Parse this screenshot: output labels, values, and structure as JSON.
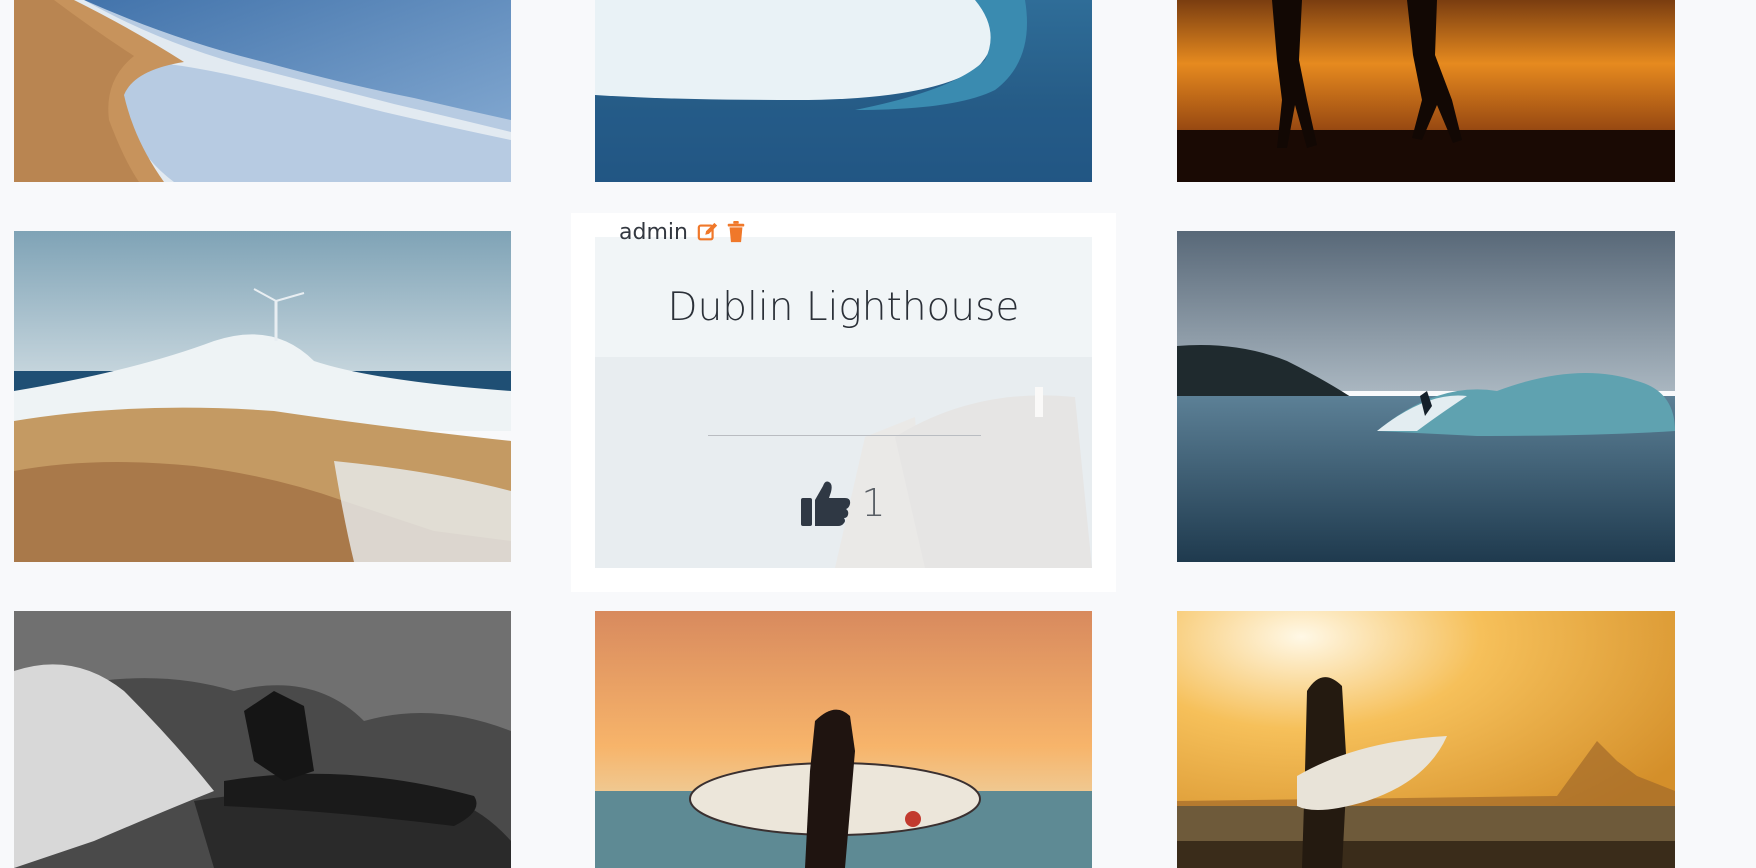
{
  "gallery": {
    "photos": [
      {
        "name": "beach-shoreline-photo"
      },
      {
        "name": "blue-wave-photo"
      },
      {
        "name": "sunset-silhouettes-photo"
      },
      {
        "name": "rocky-coast-wind-turbine-photo"
      },
      {
        "name": "dublin-lighthouse-photo"
      },
      {
        "name": "surfer-riding-wave-photo"
      },
      {
        "name": "black-white-surfer-photo"
      },
      {
        "name": "surfer-carrying-board-sunset-photo"
      },
      {
        "name": "woman-with-surfboard-photo"
      }
    ]
  },
  "selected_card": {
    "author": "admin",
    "title": "Dublin Lighthouse",
    "like_count": "1",
    "edit_icon": "edit-icon",
    "delete_icon": "trash-icon",
    "like_icon": "thumbs-up-icon",
    "accent_color": "#f0782a"
  }
}
